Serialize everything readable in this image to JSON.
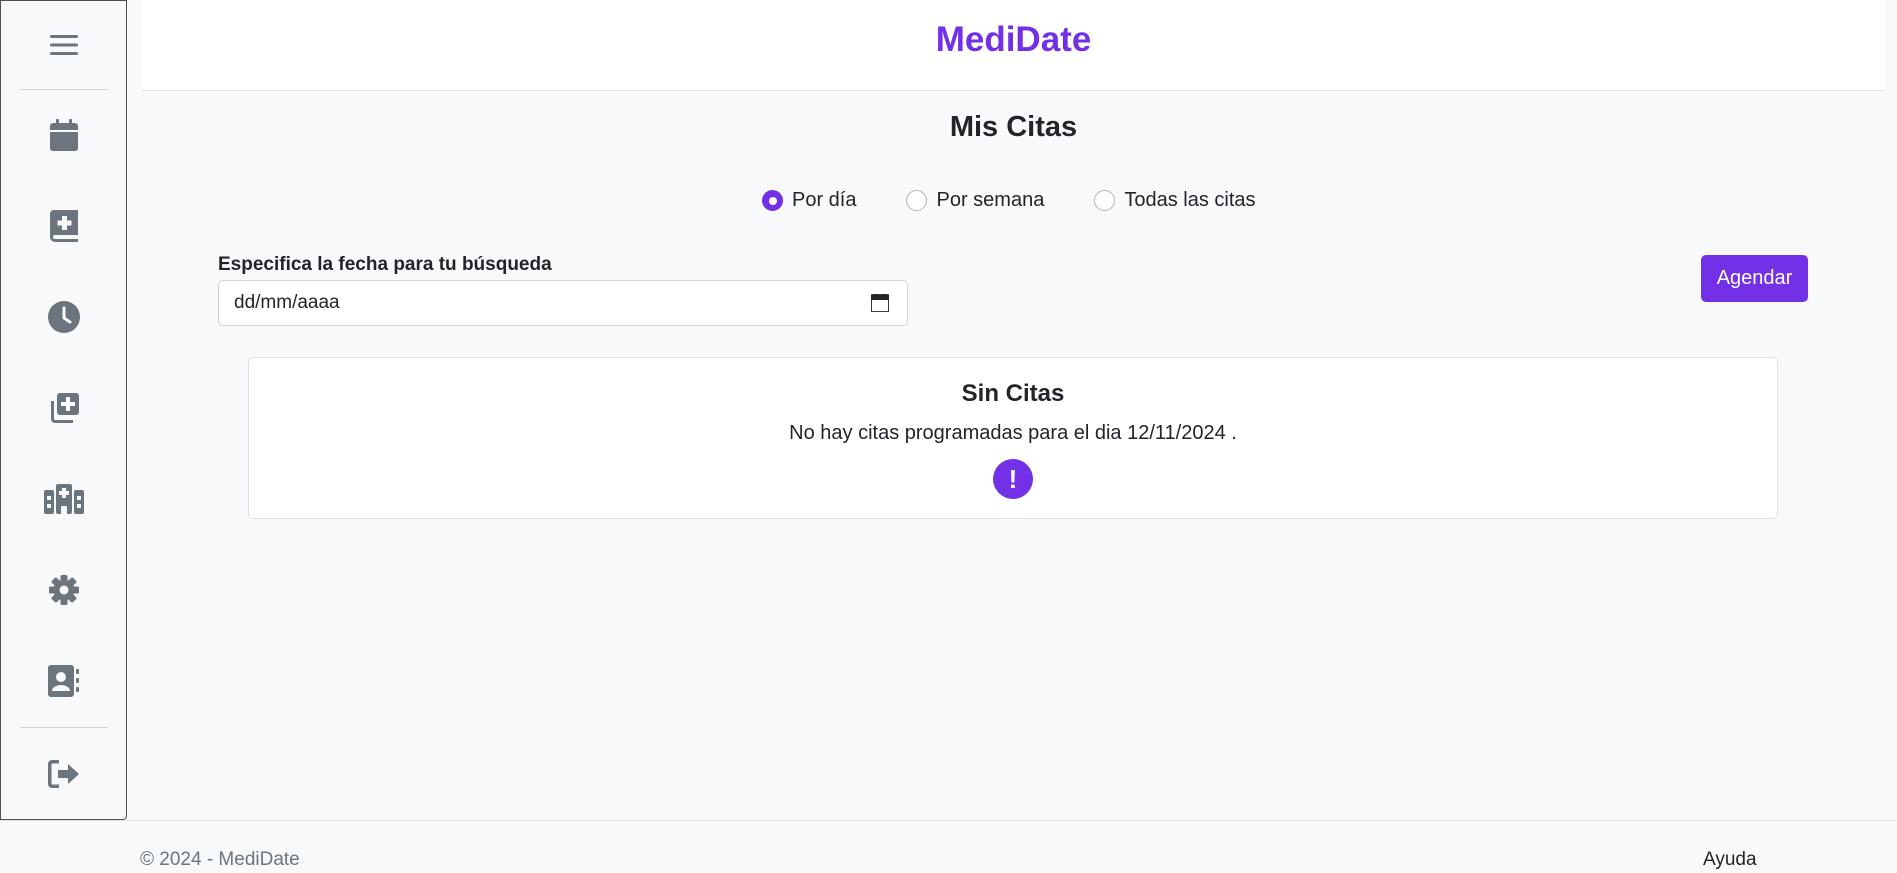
{
  "app": {
    "brand": "MediDate",
    "accent_color": "#7231e6"
  },
  "sidebar": {
    "menu_icon": "hamburger-icon",
    "items": [
      {
        "icon": "calendar-icon",
        "name": "calendar"
      },
      {
        "icon": "medical-book-icon",
        "name": "medical-book"
      },
      {
        "icon": "clock-icon",
        "name": "history"
      },
      {
        "icon": "add-copy-icon",
        "name": "add-appointment"
      },
      {
        "icon": "hospital-icon",
        "name": "hospital"
      },
      {
        "icon": "gear-icon",
        "name": "settings"
      },
      {
        "icon": "contact-book-icon",
        "name": "contacts"
      }
    ],
    "logout_icon": "logout-icon"
  },
  "main": {
    "title": "Mis Citas",
    "filters": [
      {
        "label": "Por día",
        "checked": true
      },
      {
        "label": "Por semana",
        "checked": false
      },
      {
        "label": "Todas las citas",
        "checked": false
      }
    ],
    "date_label": "Especifica la fecha para tu búsqueda",
    "date_placeholder": "dd/mm/aaaa",
    "schedule_button": "Agendar",
    "empty": {
      "title": "Sin Citas",
      "message": "No hay citas programadas para el dia 12/11/2024 .",
      "icon": "exclamation-icon"
    }
  },
  "footer": {
    "copyright": "© 2024 - MediDate",
    "help": "Ayuda"
  }
}
